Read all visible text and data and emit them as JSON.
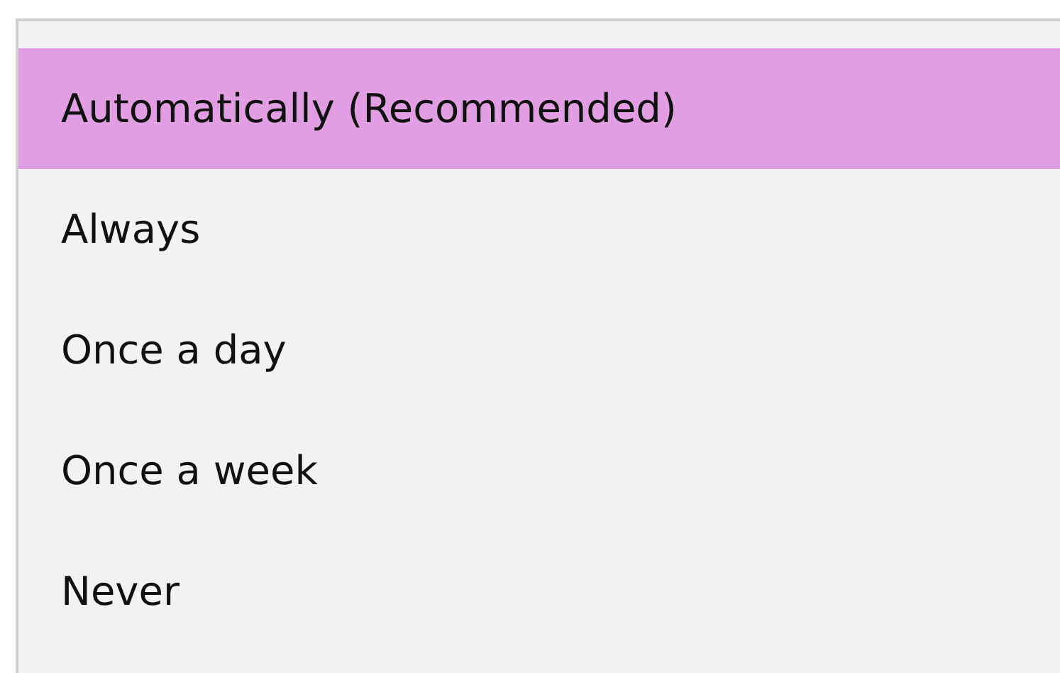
{
  "dropdown": {
    "options": [
      {
        "label": "Automatically (Recommended)",
        "selected": true
      },
      {
        "label": "Always",
        "selected": false
      },
      {
        "label": "Once a day",
        "selected": false
      },
      {
        "label": "Once a week",
        "selected": false
      },
      {
        "label": "Never",
        "selected": false
      }
    ]
  }
}
